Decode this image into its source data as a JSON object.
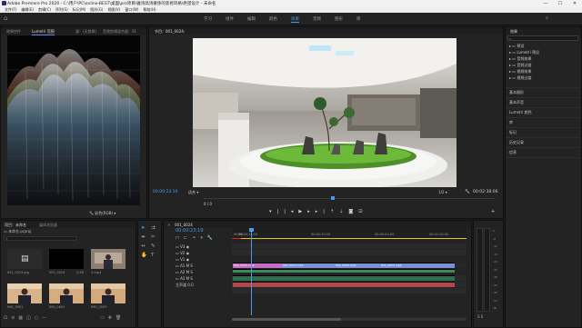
{
  "window": {
    "title": "Adobe Premiere Pro 2020 - C:\\用户\\PC\\online-BEST\\桌面\\pro项目\\雅诗高诗奢侈的装修风格\\绝望设计 - 未命名",
    "minimize": "—",
    "maximize": "☐",
    "close": "✕"
  },
  "menu": [
    "文件(F)",
    "编辑(E)",
    "剪辑(C)",
    "序列(S)",
    "标记(M)",
    "图形(G)",
    "视图(V)",
    "窗口(W)",
    "帮助(H)"
  ],
  "workspaces": [
    "学习",
    "组件",
    "编辑",
    "颜色",
    "效果",
    "音频",
    "图形",
    "库"
  ],
  "active_workspace": "效果",
  "scopes_panel": {
    "tabs": [
      "效果控件",
      "Lumetri 范围",
      "源：(无剪辑)",
      "音频剪辑混合器：01"
    ],
    "active_tab": "Lumetri 范围",
    "footer_label": "彩色(RGB)"
  },
  "program_monitor": {
    "title": "节目：001_0024",
    "timecode": "00:00:23:19",
    "fit": "适合",
    "quality": "1/2",
    "duration": "00:02:38:06",
    "zoom_marker": "0 / 0"
  },
  "project_panel": {
    "tabs": [
      "项目：未命名",
      "媒体浏览器"
    ],
    "search_placeholder": "",
    "project_file": "未命名.prproj",
    "items": [
      {
        "name": "001_0024.jpg",
        "dur": ""
      },
      {
        "name": "001_0024",
        "dur": "2:38"
      },
      {
        "name": "3.mp4",
        "dur": ""
      },
      {
        "name": "IMG_0001",
        "dur": ""
      },
      {
        "name": "IMG_0002",
        "dur": ""
      },
      {
        "name": "IMG_0003",
        "dur": ""
      }
    ]
  },
  "timeline": {
    "tab": "001_0024",
    "timecode": "00:00:23:19",
    "ruler": [
      "00:00",
      "00:00:15:00",
      "00:00:30:00",
      "00:00:45:00",
      "00:01:00:00",
      "00:01:15:00"
    ],
    "video_tracks": [
      "V3",
      "V2",
      "V1"
    ],
    "audio_tracks": [
      "A1",
      "A2",
      "A3"
    ],
    "master": "主声道",
    "master_value": "0.0",
    "clips": [
      "001_0024.mp4",
      "001_0024.mp4",
      "001_0024.mp4",
      "001_0024.mp4"
    ]
  },
  "meter_scale": [
    "0",
    "-6",
    "-12",
    "-18",
    "-24",
    "-30",
    "-36",
    "-42",
    "-48",
    "-54",
    "dB"
  ],
  "meter_footer": "S S",
  "effects_panel": {
    "title": "效果",
    "tree": [
      "预设",
      "Lumetri 预设",
      "音频效果",
      "音频过渡",
      "视频效果",
      "视频过渡"
    ],
    "sections": [
      "基本图形",
      "基本声音",
      "Lumetri 颜色",
      "库",
      "标记",
      "历史记录",
      "信息"
    ]
  }
}
